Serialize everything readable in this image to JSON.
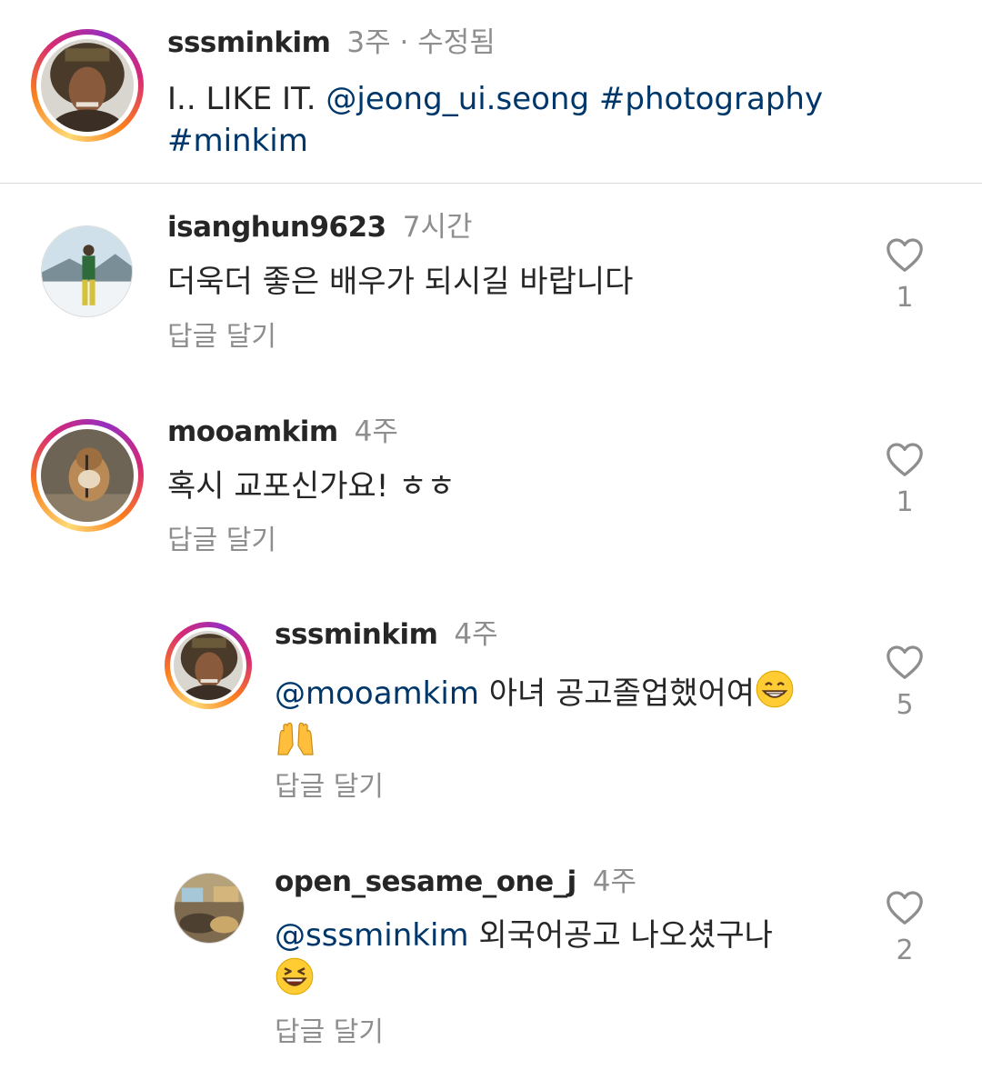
{
  "caption": {
    "username": "sssminkim",
    "time": "3주 · 수정됨",
    "text_plain": "I.. LIKE IT. ",
    "mention": "@jeong_ui.seong",
    "hashtag1": " #photography",
    "hashtag2": "#minkim"
  },
  "comments": [
    {
      "username": "isanghun9623",
      "time": "7시간",
      "text": "더욱더 좋은 배우가 되시길 바랍니다",
      "reply_label": "답글 달기",
      "likes": "1"
    },
    {
      "username": "mooamkim",
      "time": "4주",
      "text": "혹시 교포신가요! ㅎㅎ",
      "reply_label": "답글 달기",
      "likes": "1"
    },
    {
      "username": "sssminkim",
      "time": "4주",
      "mention": "@mooamkim",
      "text": " 아녀 공고졸업했어여",
      "reply_label": "답글 달기",
      "likes": "5"
    },
    {
      "username": "open_sesame_one_j",
      "time": "4주",
      "mention": "@sssminkim",
      "text": " 외국어공고 나오셨구나",
      "reply_label": "답글 달기",
      "likes": "2"
    }
  ],
  "colors": {
    "text": "#262626",
    "secondary": "#8e8e8e",
    "link": "#00376b",
    "divider": "#dbdbdb"
  },
  "icons": [
    "heart-outline-icon",
    "grinning-emoji-icon",
    "raised-hands-emoji-icon",
    "laughing-emoji-icon"
  ]
}
